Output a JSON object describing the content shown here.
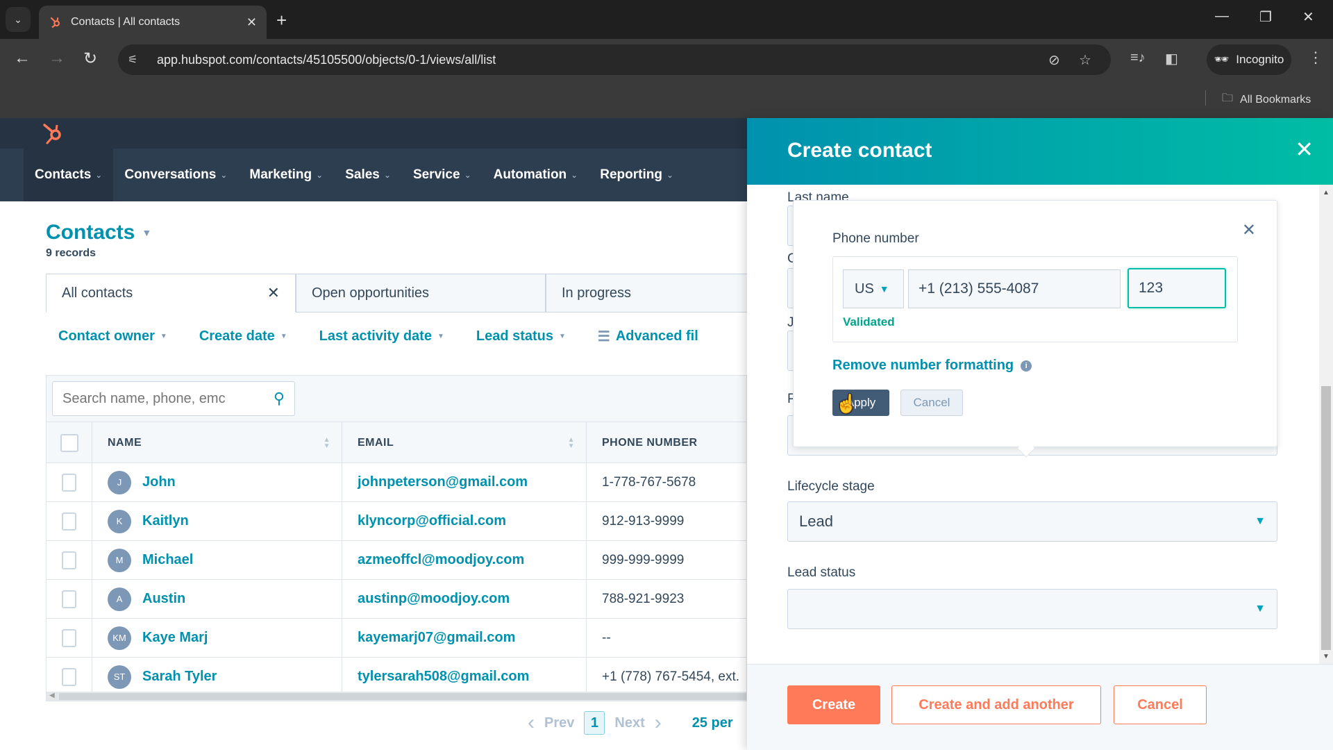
{
  "browser": {
    "tab_title": "Contacts | All contacts",
    "url": "app.hubspot.com/contacts/45105500/objects/0-1/views/all/list",
    "profile_label": "Incognito",
    "bookmarks_label": "All Bookmarks"
  },
  "nav": {
    "items": [
      {
        "label": "Contacts"
      },
      {
        "label": "Conversations"
      },
      {
        "label": "Marketing"
      },
      {
        "label": "Sales"
      },
      {
        "label": "Service"
      },
      {
        "label": "Automation"
      },
      {
        "label": "Reporting"
      }
    ]
  },
  "page": {
    "title": "Contacts",
    "record_count": "9 records",
    "view_tabs": [
      {
        "label": "All contacts",
        "active": true
      },
      {
        "label": "Open opportunities"
      },
      {
        "label": "In progress"
      }
    ],
    "filters": [
      {
        "label": "Contact owner"
      },
      {
        "label": "Create date"
      },
      {
        "label": "Last activity date"
      },
      {
        "label": "Lead status"
      },
      {
        "label": "Advanced fil"
      }
    ],
    "search_placeholder": "Search name, phone, emc"
  },
  "table": {
    "columns": [
      "NAME",
      "EMAIL",
      "PHONE NUMBER"
    ],
    "rows": [
      {
        "initials": "J",
        "name": "John",
        "email": "johnpeterson@gmail.com",
        "phone": "1-778-767-5678"
      },
      {
        "initials": "K",
        "name": "Kaitlyn",
        "email": "klyncorp@official.com",
        "phone": "912-913-9999"
      },
      {
        "initials": "M",
        "name": "Michael",
        "email": "azmeoffcl@moodjoy.com",
        "phone": "999-999-9999"
      },
      {
        "initials": "A",
        "name": "Austin",
        "email": "austinp@moodjoy.com",
        "phone": "788-921-9923"
      },
      {
        "initials": "KM",
        "name": "Kaye Marj",
        "email": "kayemarj07@gmail.com",
        "phone": "--"
      },
      {
        "initials": "ST",
        "name": "Sarah Tyler",
        "email": "tylersarah508@gmail.com",
        "phone": "+1 (778) 767-5454, ext."
      }
    ]
  },
  "pagination": {
    "prev_label": "Prev",
    "current_page": "1",
    "next_label": "Next",
    "per_page_label": "25 per"
  },
  "panel": {
    "title": "Create contact",
    "fields": {
      "last_name_label": "Last name",
      "hidden_label_1": "C",
      "hidden_label_2": "J",
      "phone_label": "Phone number",
      "lifecycle_label": "Lifecycle stage",
      "lifecycle_value": "Lead",
      "lead_status_label": "Lead status",
      "lead_status_value": ""
    },
    "buttons": {
      "create": "Create",
      "create_another": "Create and add another",
      "cancel": "Cancel"
    }
  },
  "popover": {
    "label": "Phone number",
    "country": "US",
    "phone_value": "+1 (213) 555-4087",
    "extension_value": "123",
    "status": "Validated",
    "remove_formatting": "Remove number formatting",
    "apply": "Apply",
    "cancel": "Cancel"
  },
  "colors": {
    "brand_orange": "#ff7a59",
    "link_teal": "#0091ae",
    "nav_dark": "#2d3e50",
    "validated_green": "#00a38d"
  }
}
